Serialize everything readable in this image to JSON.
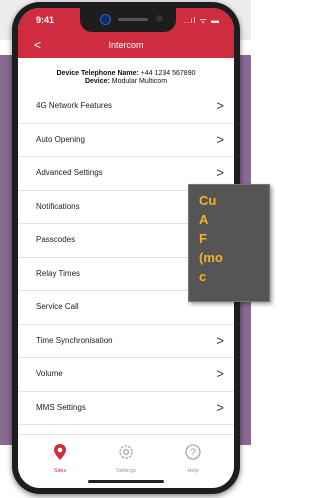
{
  "status_bar": {
    "time": "9:41",
    "icons": "..ıl ᯤ ▬"
  },
  "nav": {
    "back": "<",
    "title": "Intercom"
  },
  "device": {
    "phone_label": "Device Telephone Name:",
    "phone_value": "+44 1234 567890",
    "device_label": "Device:",
    "device_value": "Modular Multicom"
  },
  "menu": [
    {
      "label": "4G Network Features",
      "chevron": ">"
    },
    {
      "label": "Auto Opening",
      "chevron": ">"
    },
    {
      "label": "Advanced Settings",
      "chevron": ">"
    },
    {
      "label": "Notifications",
      "chevron": ""
    },
    {
      "label": "Passcodes",
      "chevron": ""
    },
    {
      "label": "Relay Times",
      "chevron": ""
    },
    {
      "label": "Service Call",
      "chevron": ""
    },
    {
      "label": "Time Synchronisation",
      "chevron": ">"
    },
    {
      "label": "Volume",
      "chevron": ">"
    },
    {
      "label": "MMS Settings",
      "chevron": ">"
    }
  ],
  "tabs": [
    {
      "label": "Sites",
      "icon": "location-pin-icon",
      "active": true
    },
    {
      "label": "Settings",
      "icon": "gear-icon",
      "active": false
    },
    {
      "label": "Help",
      "icon": "question-icon",
      "active": false
    }
  ],
  "callout": {
    "text": "Cu\nA\nF\n(mo\nc"
  },
  "colors": {
    "brand_red": "#cf2c40",
    "callout_bg": "#555555",
    "callout_text": "#f4b22a",
    "backdrop": "#8a6a93"
  }
}
